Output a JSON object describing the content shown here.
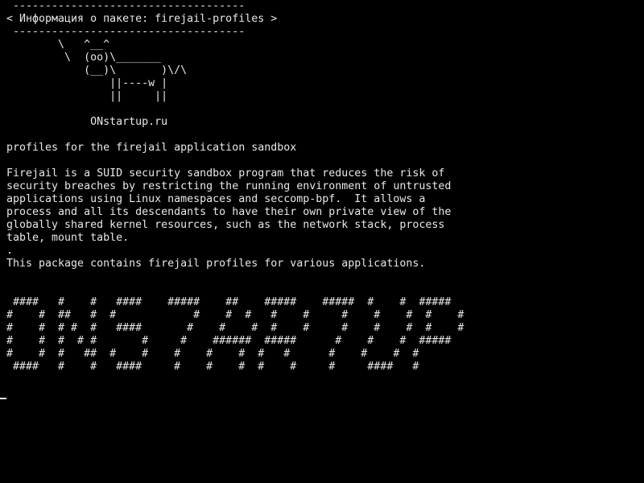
{
  "terminal": {
    "cowsay": [
      " ------------------------------------",
      "< Информация о пакете: firejail-profiles >",
      " ------------------------------------",
      "        \\   ^__^",
      "         \\  (oo)\\_______",
      "            (__)\\       )\\/\\",
      "                ||----w |",
      "                ||     ||",
      "",
      "             ONstartup.ru"
    ],
    "description": [
      "profiles for the firejail application sandbox",
      "",
      "Firejail is a SUID security sandbox program that reduces the risk of",
      "security breaches by restricting the running environment of untrusted",
      "applications using Linux namespaces and seccomp-bpf.  It allows a",
      "process and all its descendants to have their own private view of the",
      "globally shared kernel resources, such as the network stack, process",
      "table, mount table.",
      ".",
      "This package contains firejail profiles for various applications."
    ],
    "banner": [
      " ####   #    #   ####    #####    ##    #####    #####  #    #  #####",
      "#    #  ##   #  #            #    #  #   #    #     #    #    #  #    #",
      "#    #  # #  #   ####       #    #    #  #    #     #    #    #  #    #",
      "#    #  #  # #       #     #    ######  #####      #    #    #  #####",
      "#    #  #   ##  #    #    #    #    #  #   #      #    #    #  #",
      " ####   #    #   ####     #    #    #  #    #     #     ####   #"
    ]
  }
}
